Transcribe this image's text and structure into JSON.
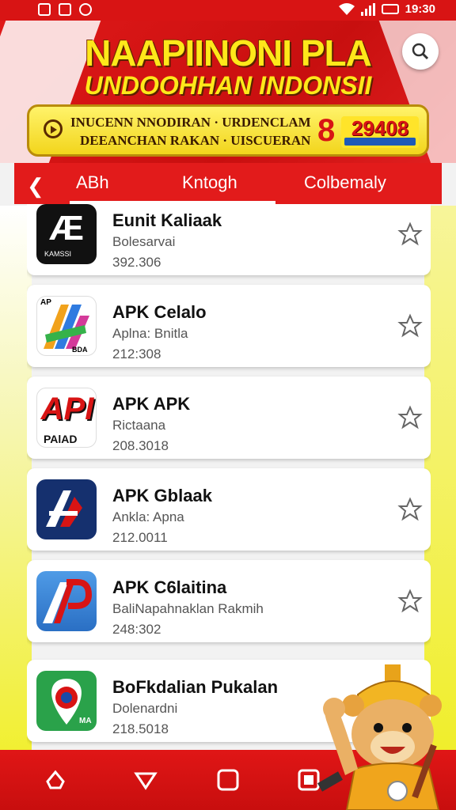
{
  "status_bar": {
    "time": "19:30"
  },
  "header": {
    "title_line1": "NAAPIINONI PLA",
    "title_line2": "UNDOOHHAN INDONSII",
    "promo_line1": "INUCENN NNODIRAN · URDENCLAM",
    "promo_line2": "DEEANCHAN RAKAN · UISCUERAN",
    "promo_digit": "8",
    "promo_number": "29408"
  },
  "tabs": {
    "items": [
      "ABh",
      "Kntogh",
      "Colbemaly"
    ],
    "active": 0
  },
  "apps": [
    {
      "name": "Eunit Kaliaak",
      "developer": "Bolesarvai",
      "size": "392.306"
    },
    {
      "name": "APK Celalo",
      "developer": "Aplna: Bnitla",
      "size": "212:308"
    },
    {
      "name": "APK APK",
      "developer": "Rictaana",
      "size": "208.3018"
    },
    {
      "name": "APK Gblaak",
      "developer": "Ankla: Apna",
      "size": "212.0011"
    },
    {
      "name": "APK C6laitina",
      "developer": "BaliNapahnaklan Rakmih",
      "size": "248:302"
    },
    {
      "name": "BoFkdalian Pukalan",
      "developer": "Dolenardni",
      "size": "218.5018"
    }
  ],
  "icon_labels": {
    "app1_mark": "Æ",
    "app1_sub": "KAMSSI",
    "app2_tag": "AP",
    "app2_sub": "BDA",
    "app3_main": "API",
    "app3_sub": "PAlAD",
    "app6_tag": "MA"
  },
  "colors": {
    "brand_red": "#d81414",
    "accent_yellow": "#ffe81a"
  }
}
